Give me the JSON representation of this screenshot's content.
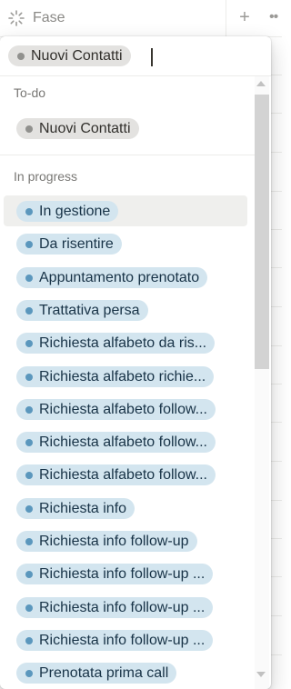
{
  "property": {
    "name": "Fase",
    "icon": "status-spinner-icon",
    "add_label": "+",
    "more_label": "••"
  },
  "colors": {
    "gray_chip_bg": "#e3e2e0",
    "gray_dot": "#91918e",
    "blue_chip_bg": "#d3e5ef",
    "blue_dot": "#5b97bd",
    "hover_bg": "#efefed"
  },
  "selected": {
    "label": "Nuovi Contatti"
  },
  "groups": [
    {
      "title": "To-do",
      "options": [
        {
          "label": "Nuovi Contatti"
        }
      ]
    },
    {
      "title": "In progress",
      "options": [
        {
          "label": "In gestione"
        },
        {
          "label": "Da risentire"
        },
        {
          "label": "Appuntamento prenotato"
        },
        {
          "label": "Trattativa persa"
        },
        {
          "label": "Richiesta alfabeto da ris..."
        },
        {
          "label": "Richiesta alfabeto richie..."
        },
        {
          "label": "Richiesta alfabeto follow..."
        },
        {
          "label": "Richiesta alfabeto follow..."
        },
        {
          "label": "Richiesta alfabeto follow..."
        },
        {
          "label": "Richiesta info"
        },
        {
          "label": "Richiesta info follow-up"
        },
        {
          "label": "Richiesta info follow-up ..."
        },
        {
          "label": "Richiesta info follow-up ..."
        },
        {
          "label": "Richiesta info follow-up ..."
        },
        {
          "label": "Prenotata prima call"
        }
      ]
    }
  ]
}
